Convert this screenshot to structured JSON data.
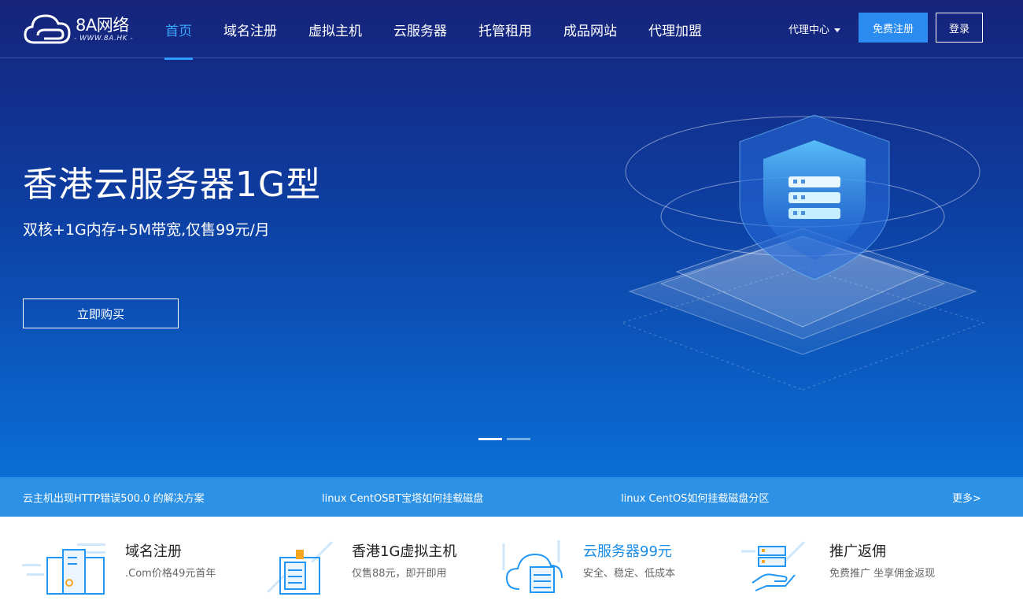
{
  "logo": {
    "brand": "8A网络",
    "domain": "- WWW.8A.HK -"
  },
  "nav": [
    {
      "label": "首页",
      "active": true
    },
    {
      "label": "域名注册"
    },
    {
      "label": "虚拟主机"
    },
    {
      "label": "云服务器"
    },
    {
      "label": "托管租用"
    },
    {
      "label": "成品网站"
    },
    {
      "label": "代理加盟"
    }
  ],
  "header": {
    "agent_label": "代理中心",
    "register_label": "免费注册",
    "login_label": "登录"
  },
  "hero": {
    "title": "香港云服务器1G型",
    "subtitle": "双核+1G内存+5M带宽,仅售99元/月",
    "button": "立即购买",
    "slide_count": 2,
    "active_slide": 1
  },
  "news": {
    "items": [
      "云主机出现HTTP错误500.0 的解决方案",
      "linux CentOSBT宝塔如何挂载磁盘",
      "linux CentOS如何挂载磁盘分区"
    ],
    "more": "更多>"
  },
  "features": [
    {
      "title": "域名注册",
      "desc": ".Com价格49元首年",
      "icon": "domain-building-icon"
    },
    {
      "title": "香港1G虚拟主机",
      "desc": "仅售88元，即开即用",
      "icon": "server-rack-icon"
    },
    {
      "title": "云服务器99元",
      "desc": "安全、稳定、低成本",
      "icon": "cloud-server-icon",
      "highlight": true
    },
    {
      "title": "推广返佣",
      "desc": "免费推广 坐享佣金返现",
      "icon": "hand-server-icon"
    }
  ],
  "colors": {
    "accent": "#2b8cf0",
    "nav_active": "#3aa8ff",
    "news_bar": "#2d92e6",
    "hero_top": "#16237a",
    "hero_bottom": "#0a6fd6"
  }
}
